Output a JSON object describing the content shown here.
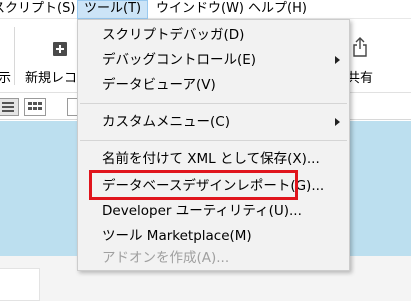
{
  "menubar": {
    "items": [
      {
        "label": "スクリプト(S)"
      },
      {
        "label": "ツール(T)"
      },
      {
        "label": "ウインドウ(W)"
      },
      {
        "label": "ヘルプ(H)"
      }
    ]
  },
  "ribbon": {
    "left_fragment": "示",
    "new_label": "新規レコ",
    "share_label": "共有"
  },
  "tools_menu": {
    "items": [
      {
        "label": "スクリプトデバッガ(D)",
        "submenu": false,
        "enabled": true
      },
      {
        "label": "デバッグコントロール(E)",
        "submenu": true,
        "enabled": true
      },
      {
        "label": "データビューア(V)",
        "submenu": false,
        "enabled": true
      },
      {
        "label": "カスタムメニュー(C)",
        "submenu": true,
        "enabled": true
      },
      {
        "label": "名前を付けて XML として保存(X)...",
        "submenu": false,
        "enabled": true
      },
      {
        "label": "データベースデザインレポート(G)...",
        "submenu": false,
        "enabled": true
      },
      {
        "label": "Developer ユーティリティ(U)...",
        "submenu": false,
        "enabled": true
      },
      {
        "label": "ツール Marketplace(M)",
        "submenu": false,
        "enabled": true
      },
      {
        "label": "アドオンを作成(A)...",
        "submenu": false,
        "enabled": false
      }
    ]
  },
  "highlight_color": "#e0151d",
  "band_color": "#bcdfef"
}
